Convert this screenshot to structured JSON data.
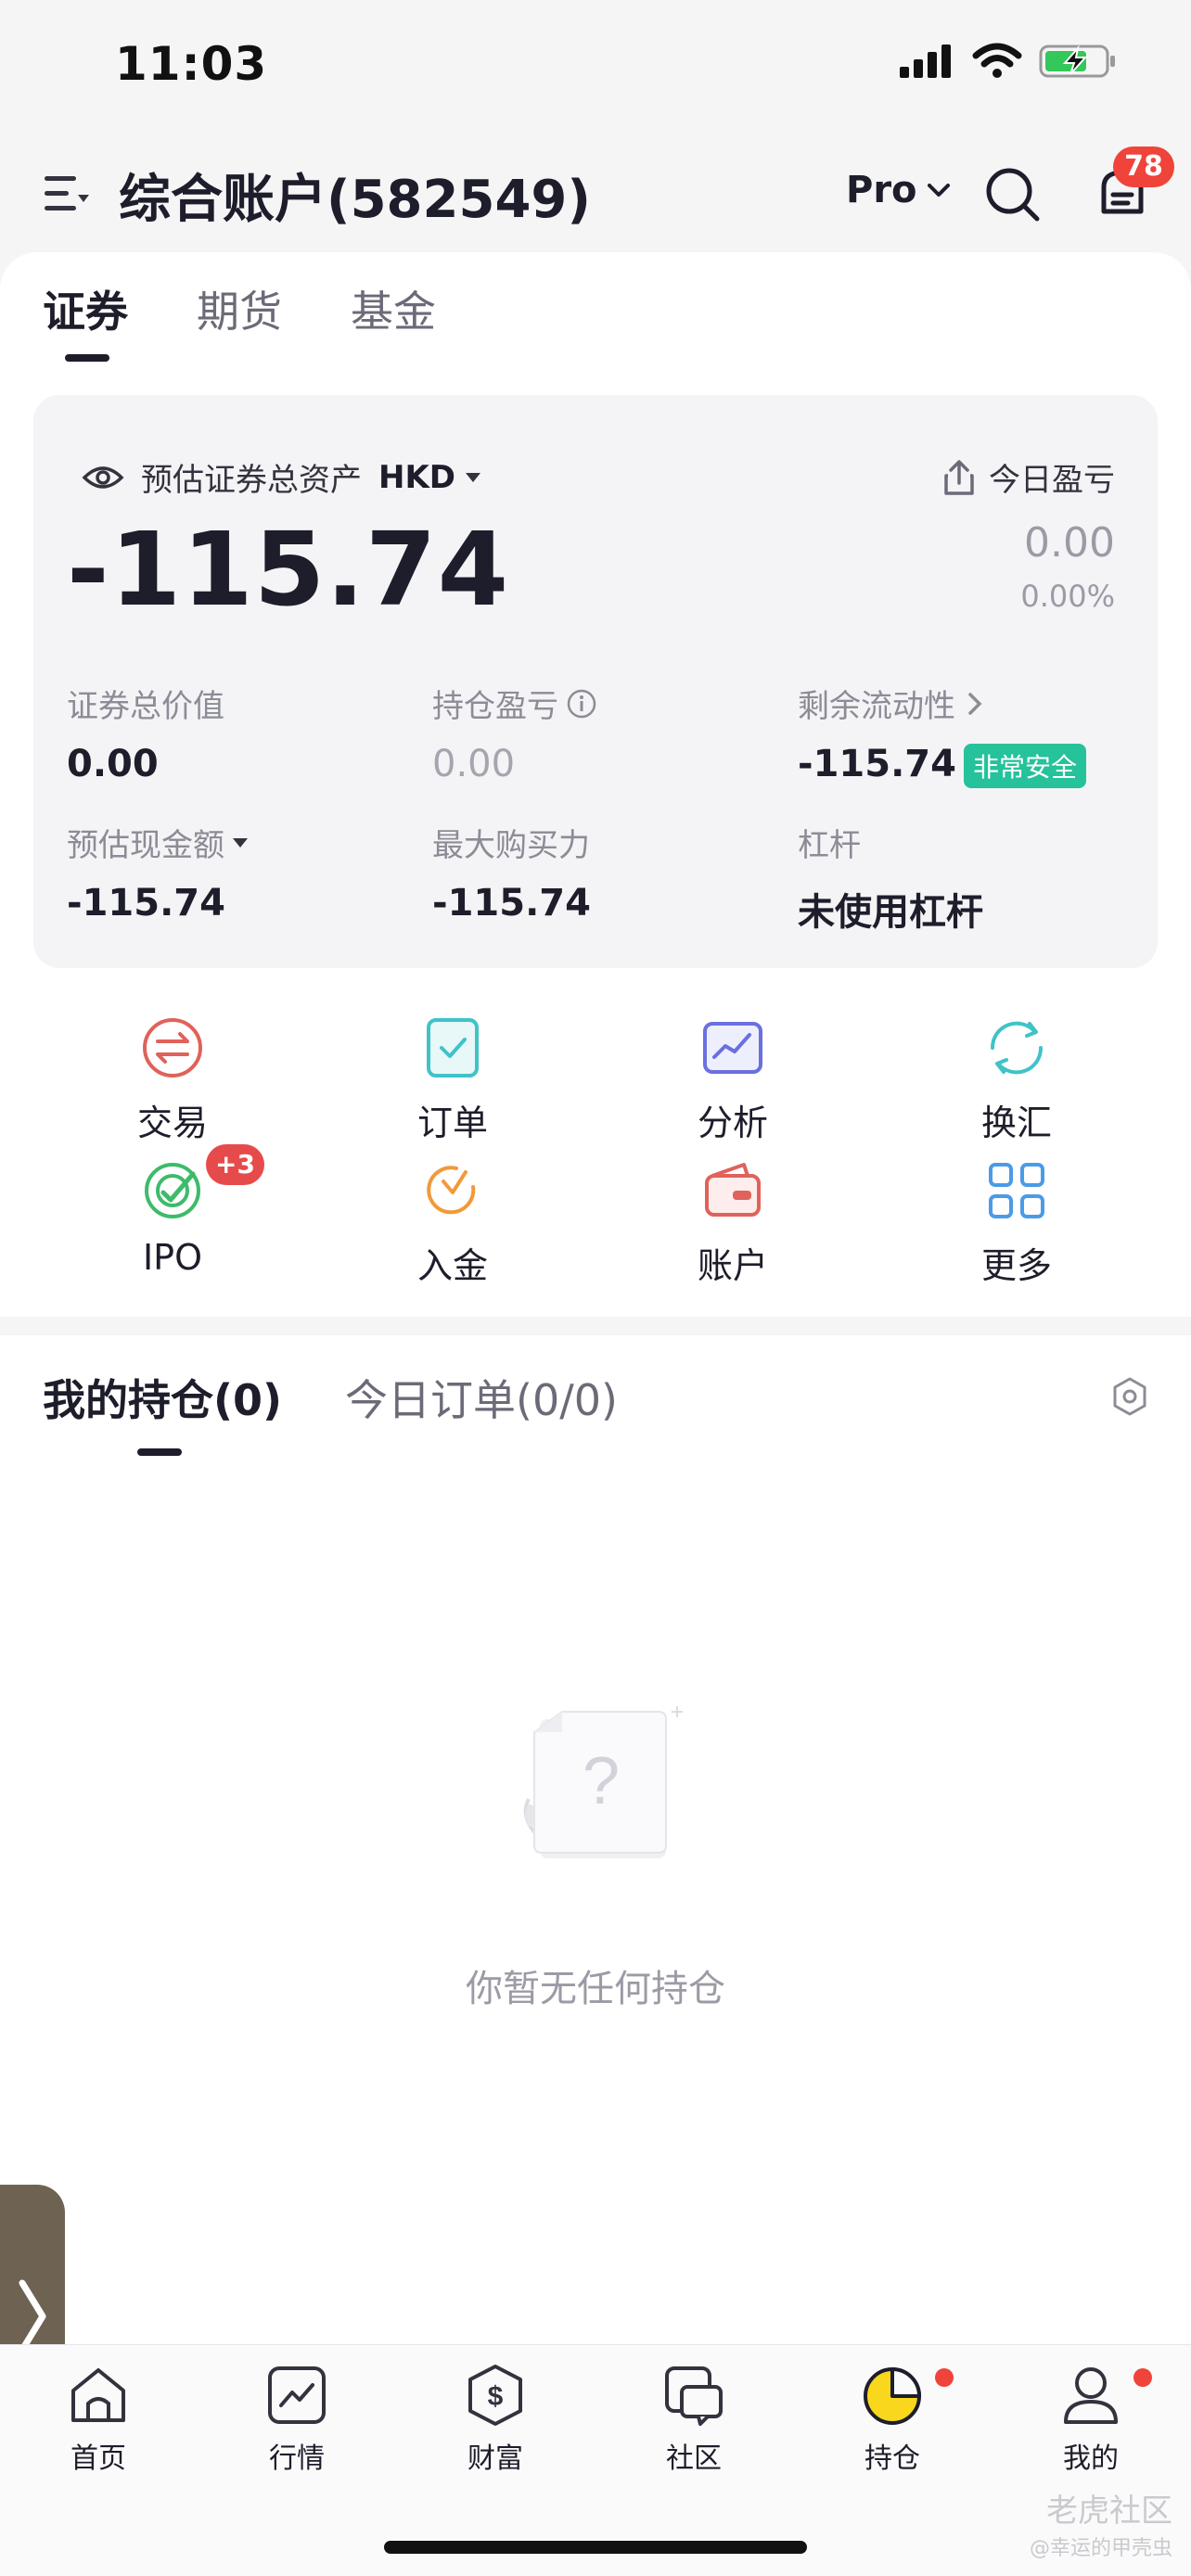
{
  "status_bar": {
    "time": "11:03"
  },
  "header": {
    "account_title": "综合账户(582549)",
    "pro_label": "Pro",
    "message_badge": "78"
  },
  "tabs": [
    "证券",
    "期货",
    "基金"
  ],
  "summary": {
    "total_assets_label": "预估证券总资产",
    "currency": "HKD",
    "total_assets_value": "-115.74",
    "today_pnl_label": "今日盈亏",
    "today_pnl_value": "0.00",
    "today_pnl_pct": "0.00%"
  },
  "metrics": [
    {
      "label": "证券总价值",
      "value": "0.00"
    },
    {
      "label": "持仓盈亏",
      "value": "0.00"
    },
    {
      "label": "剩余流动性",
      "value": "-115.74",
      "badge": "非常安全"
    },
    {
      "label": "预估现金额",
      "value": "-115.74"
    },
    {
      "label": "最大购买力",
      "value": "-115.74"
    },
    {
      "label": "杠杆",
      "value": "未使用杠杆"
    }
  ],
  "quick_actions": [
    {
      "label": "交易",
      "icon": "exchange-arrows-icon",
      "color": "#e0625a"
    },
    {
      "label": "订单",
      "icon": "order-check-icon",
      "color": "#3fc3c8"
    },
    {
      "label": "分析",
      "icon": "analysis-chart-icon",
      "color": "#6a6fe0"
    },
    {
      "label": "换汇",
      "icon": "currency-swap-icon",
      "color": "#3fc3c8"
    },
    {
      "label": "IPO",
      "icon": "ipo-target-icon",
      "color": "#3dbb6a",
      "badge": "+3"
    },
    {
      "label": "入金",
      "icon": "deposit-icon",
      "color": "#f19a3a"
    },
    {
      "label": "账户",
      "icon": "wallet-icon",
      "color": "#e0625a"
    },
    {
      "label": "更多",
      "icon": "grid-more-icon",
      "color": "#4a9be8"
    }
  ],
  "holdings_tabs": [
    "我的持仓(0)",
    "今日订单(0/0)"
  ],
  "empty_text": "你暂无任何持仓",
  "bottom_nav": [
    {
      "label": "首页",
      "icon": "home-icon"
    },
    {
      "label": "行情",
      "icon": "market-chart-icon"
    },
    {
      "label": "财富",
      "icon": "wealth-dollar-icon"
    },
    {
      "label": "社区",
      "icon": "community-chat-icon"
    },
    {
      "label": "持仓",
      "icon": "holdings-pie-icon",
      "active": true,
      "dot": true
    },
    {
      "label": "我的",
      "icon": "profile-icon",
      "dot": true
    }
  ],
  "watermark": "老虎社区",
  "watermark_sub": "@幸运的甲壳虫",
  "colors": {
    "accent_yellow": "#f9d71c",
    "danger": "#f0433a",
    "safe_green": "#25c29b"
  }
}
